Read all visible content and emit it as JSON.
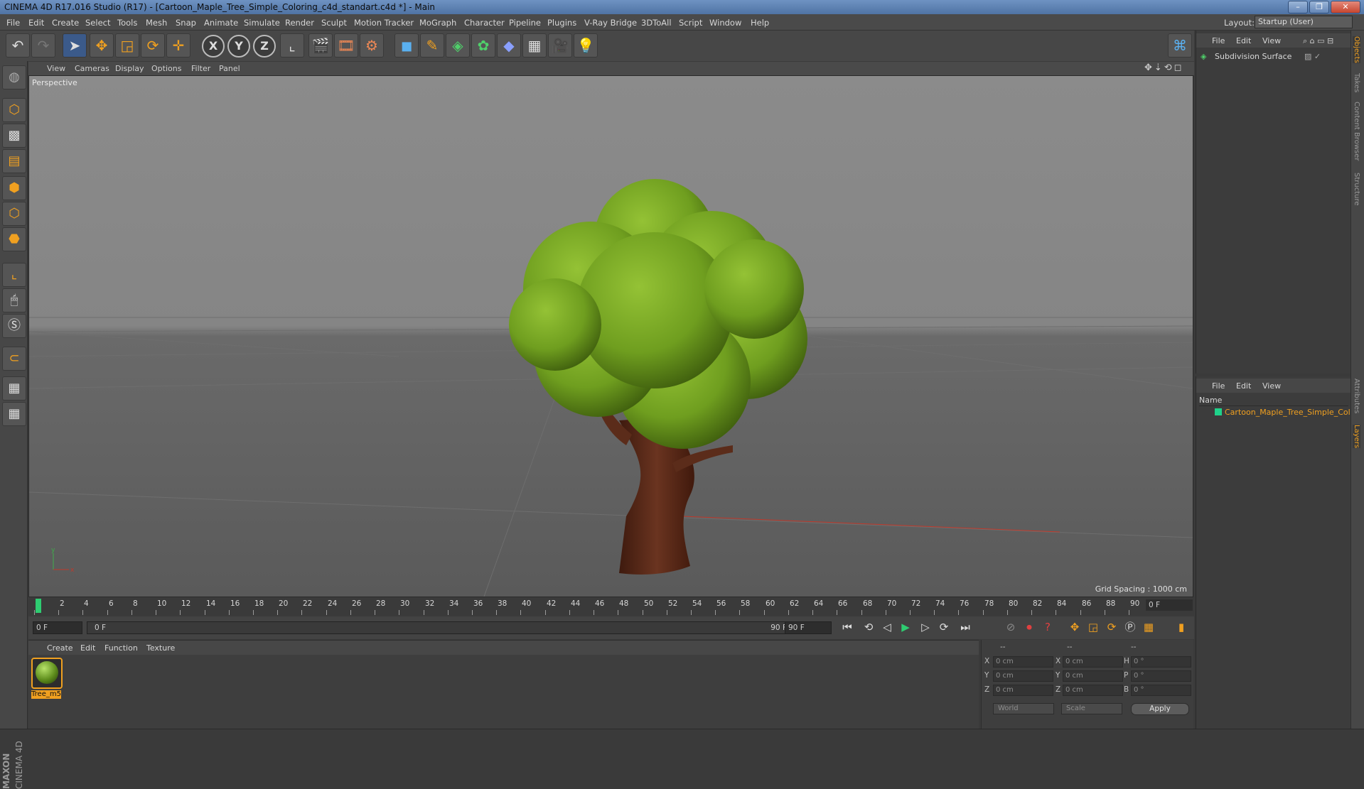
{
  "window": {
    "title": "CINEMA 4D R17.016 Studio (R17) - [Cartoon_Maple_Tree_Simple_Coloring_c4d_standart.c4d *] - Main",
    "min": "–",
    "max": "❐",
    "close": "✕"
  },
  "menu": [
    "File",
    "Edit",
    "Create",
    "Select",
    "Tools",
    "Mesh",
    "Snap",
    "Animate",
    "Simulate",
    "Render",
    "Sculpt",
    "Motion Tracker",
    "MoGraph",
    "Character",
    "Pipeline",
    "Plugins",
    "V-Ray Bridge",
    "3DToAll",
    "Script",
    "Window",
    "Help"
  ],
  "layout": {
    "label": "Layout:",
    "value": "Startup (User)"
  },
  "toolbar": {
    "x_axis": "X",
    "y_axis": "Y",
    "z_axis": "Z"
  },
  "viewport": {
    "menu": [
      "View",
      "Cameras",
      "Display",
      "Options",
      "Filter",
      "Panel"
    ],
    "label": "Perspective",
    "grid_spacing": "Grid Spacing : 1000 cm"
  },
  "timeline": {
    "ticks": [
      "0",
      "2",
      "4",
      "6",
      "8",
      "10",
      "12",
      "14",
      "16",
      "18",
      "20",
      "22",
      "24",
      "26",
      "28",
      "30",
      "32",
      "34",
      "36",
      "38",
      "40",
      "42",
      "44",
      "46",
      "48",
      "50",
      "52",
      "54",
      "56",
      "58",
      "60",
      "62",
      "64",
      "66",
      "68",
      "70",
      "72",
      "74",
      "76",
      "78",
      "80",
      "82",
      "84",
      "86",
      "88",
      "90"
    ],
    "current_frame": "0 F"
  },
  "transport": {
    "start": "0 F",
    "range_start": "0 F",
    "range_end": "90 F",
    "end": "90 F"
  },
  "materials": {
    "menu": [
      "Create",
      "Edit",
      "Function",
      "Texture"
    ],
    "items": [
      {
        "name": "Tree_m5"
      }
    ]
  },
  "coordinates": {
    "headers": [
      "--",
      "--",
      "--"
    ],
    "rows": [
      {
        "a": "X",
        "av": "0 cm",
        "b": "X",
        "bv": "0 cm",
        "c": "H",
        "cv": "0 °"
      },
      {
        "a": "Y",
        "av": "0 cm",
        "b": "Y",
        "bv": "0 cm",
        "c": "P",
        "cv": "0 °"
      },
      {
        "a": "Z",
        "av": "0 cm",
        "b": "Z",
        "bv": "0 cm",
        "c": "B",
        "cv": "0 °"
      }
    ],
    "mode1": "World",
    "mode2": "Scale",
    "apply": "Apply"
  },
  "objects": {
    "menu": [
      "File",
      "Edit",
      "View"
    ],
    "items": [
      {
        "name": "Subdivision Surface"
      }
    ]
  },
  "layers": {
    "menu": [
      "File",
      "Edit",
      "View"
    ],
    "name_header": "Name",
    "items": [
      {
        "name": "Cartoon_Maple_Tree_Simple_Coloring"
      }
    ]
  },
  "side_tabs": [
    "Objects",
    "Takes",
    "Content Browser",
    "Structure",
    "Attributes",
    "Layers"
  ],
  "brand": {
    "line1": "MAXON",
    "line2": "CINEMA 4D"
  },
  "colors": {
    "accent": "#f0a020",
    "layer_swatch": "#1fd28a",
    "foliage": "#7fb12a",
    "trunk": "#5a2a1a"
  }
}
